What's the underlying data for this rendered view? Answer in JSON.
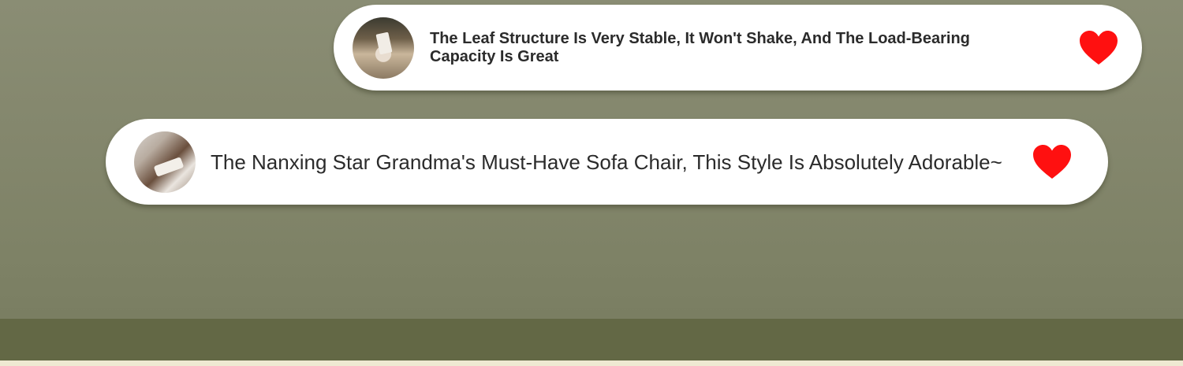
{
  "comments": [
    {
      "text": "The Leaf Structure Is Very Stable, It Won't Shake, And The Load-Bearing Capacity Is Great",
      "avatar_icon": "user-avatar-photo",
      "like_icon": "heart-icon",
      "like_color": "#ff1010",
      "liked": true
    },
    {
      "text": "The Nanxing Star Grandma's Must-Have Sofa Chair, This Style Is Absolutely Adorable~",
      "avatar_icon": "user-avatar-photo",
      "like_icon": "heart-icon",
      "like_color": "#ff1010",
      "liked": true
    }
  ],
  "colors": {
    "background": "#84876d",
    "bottom_band": "#636845",
    "bottom_edge": "#efe9d2",
    "bubble": "#ffffff"
  }
}
